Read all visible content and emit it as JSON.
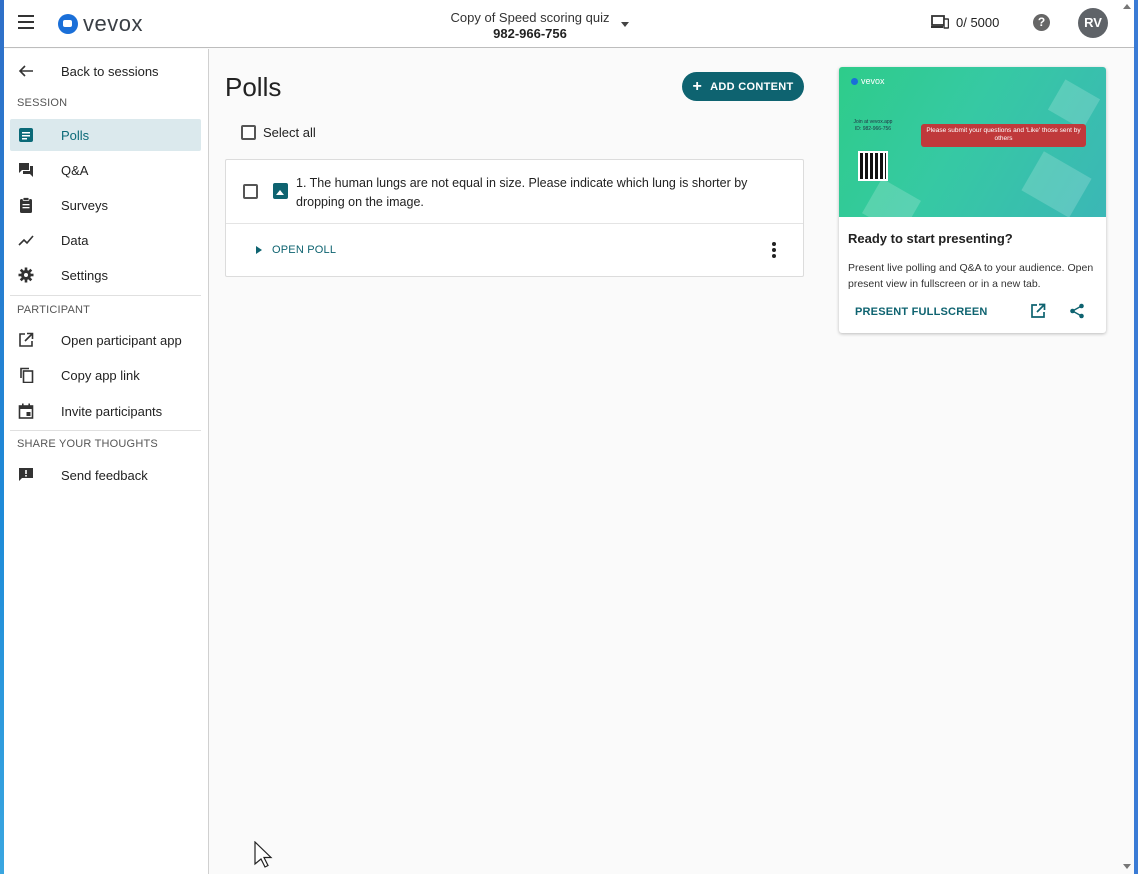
{
  "header": {
    "logo_text": "vevox",
    "session_title": "Copy of Speed scoring quiz",
    "session_id": "982-966-756",
    "device_count": "0/ 5000",
    "help_glyph": "?",
    "avatar_initials": "RV"
  },
  "sidebar": {
    "back_label": "Back to sessions",
    "session_section": "SESSION",
    "session_items": [
      {
        "label": "Polls",
        "icon": "polls-icon",
        "active": true
      },
      {
        "label": "Q&A",
        "icon": "qa-icon"
      },
      {
        "label": "Surveys",
        "icon": "clipboard-icon"
      },
      {
        "label": "Data",
        "icon": "chart-line-icon"
      },
      {
        "label": "Settings",
        "icon": "gear-icon"
      }
    ],
    "participant_section": "PARTICIPANT",
    "participant_items": [
      {
        "label": "Open participant app",
        "icon": "open-external-icon"
      },
      {
        "label": "Copy app link",
        "icon": "copy-icon"
      },
      {
        "label": "Invite participants",
        "icon": "calendar-icon"
      }
    ],
    "thoughts_section": "SHARE YOUR THOUGHTS",
    "thoughts_items": [
      {
        "label": "Send feedback",
        "icon": "feedback-icon"
      }
    ]
  },
  "main": {
    "title": "Polls",
    "add_content_label": "ADD CONTENT",
    "select_all_label": "Select all",
    "polls": [
      {
        "text": "1. The human lungs are not equal in size. Please indicate which lung is shorter by dropping on the image.",
        "open_label": "OPEN POLL"
      }
    ]
  },
  "present_card": {
    "preview_logo": "vevox",
    "preview_join": "Join at vevox.app ID: 982-966-756",
    "preview_banner": "Please submit your questions and 'Like' those sent by others",
    "title": "Ready to start presenting?",
    "description": "Present live polling and Q&A to your audience. Open present view in fullscreen or in a new tab.",
    "present_button": "PRESENT FULLSCREEN"
  },
  "colors": {
    "accent": "#0e6370",
    "active_bg": "#dbe9ed",
    "banner": "#c0393b"
  }
}
